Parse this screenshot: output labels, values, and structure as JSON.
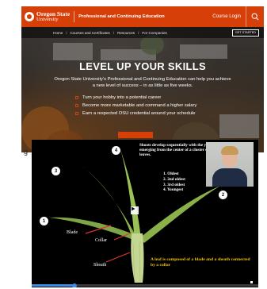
{
  "header": {
    "logo_line1": "Oregon State",
    "logo_line2": "University",
    "title": "Professional and Continuing Education",
    "course_login": "Course Login",
    "search_icon": "search-icon",
    "brand_color": "#d73f09"
  },
  "breadcrumb": {
    "items": [
      "Home",
      "Courses and Certificates",
      "Resources",
      "For Companies"
    ],
    "separator": "/"
  },
  "get_started_label": "GET STARTED",
  "hero": {
    "title": "LEVEL UP YOUR SKILLS",
    "subtitle": "Oregon State University's Professional and Continuing Education can help you achieve a new level of success – in as little as five weeks.",
    "bullets": [
      "Turn your hobby into a potential career",
      "Become more marketable and command a higher salary",
      "Earn a respected OSU credential around your schedule"
    ]
  },
  "left_peek_text": "g",
  "video": {
    "headline": "Shoots develop sequentially with the youngest leaf emerging from the center of a cluster of mature leaves.",
    "ages": [
      "1.  Oldest",
      "2.  2nd oldest",
      "3.  3rd oldest",
      "4.  Youngest"
    ],
    "labels": {
      "blade": "Blade",
      "collar": "Collar",
      "sheath": "Sheath"
    },
    "markers": [
      "1",
      "2",
      "3",
      "4"
    ],
    "caption": "A leaf is composed of a blade and a sheath connected by a collar",
    "progress": 0.19,
    "accent_color": "#3f8de0",
    "caption_color": "#f2c400"
  }
}
